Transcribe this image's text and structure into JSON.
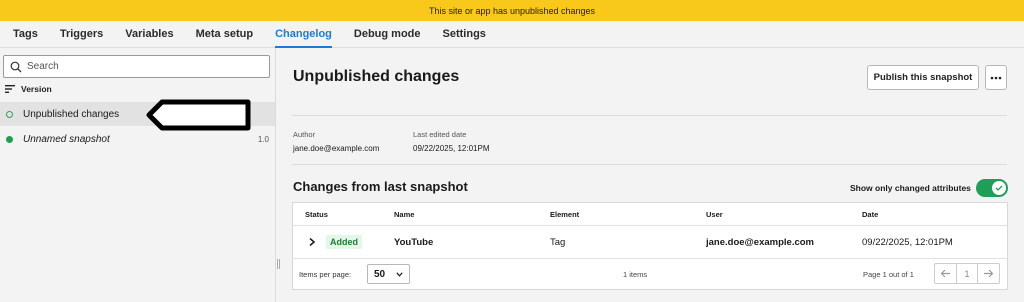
{
  "banner": {
    "text": "This site or app has unpublished changes"
  },
  "nav": {
    "tabs": [
      {
        "label": "Tags"
      },
      {
        "label": "Triggers"
      },
      {
        "label": "Variables"
      },
      {
        "label": "Meta setup"
      },
      {
        "label": "Changelog",
        "active": true
      },
      {
        "label": "Debug mode"
      },
      {
        "label": "Settings"
      }
    ]
  },
  "sidebar": {
    "search_placeholder": "Search",
    "sort_label": "Version",
    "items": [
      {
        "label": "Unpublished changes",
        "status": "unpublished",
        "selected": true,
        "version": ""
      },
      {
        "label": "Unnamed snapshot",
        "status": "published",
        "selected": false,
        "version": "1.0"
      }
    ]
  },
  "main": {
    "title": "Unpublished changes",
    "publish_button": "Publish this snapshot",
    "more_icon": "more-horizontal-icon",
    "author_label": "Author",
    "author_value": "jane.doe@example.com",
    "edited_label": "Last edited date",
    "edited_value": "09/22/2025, 12:01PM",
    "changes_title": "Changes from last snapshot",
    "toggle_label": "Show only changed attributes",
    "toggle_on": true
  },
  "table": {
    "columns": [
      "Status",
      "Name",
      "Element",
      "User",
      "Date"
    ],
    "rows": [
      {
        "status": "Added",
        "name": "YouTube",
        "element": "Tag",
        "user": "jane.doe@example.com",
        "date": "09/22/2025, 12:01PM"
      }
    ],
    "items_per_page_label": "Items per page:",
    "items_per_page_value": "50",
    "items_count": "1 items",
    "page_info": "Page 1 out of 1",
    "current_page": "1"
  },
  "colors": {
    "banner": "#f8c91a",
    "active_tab": "#1f7ad6",
    "status_green": "#1e9e4e",
    "added_badge_bg": "#e3f6e8"
  }
}
